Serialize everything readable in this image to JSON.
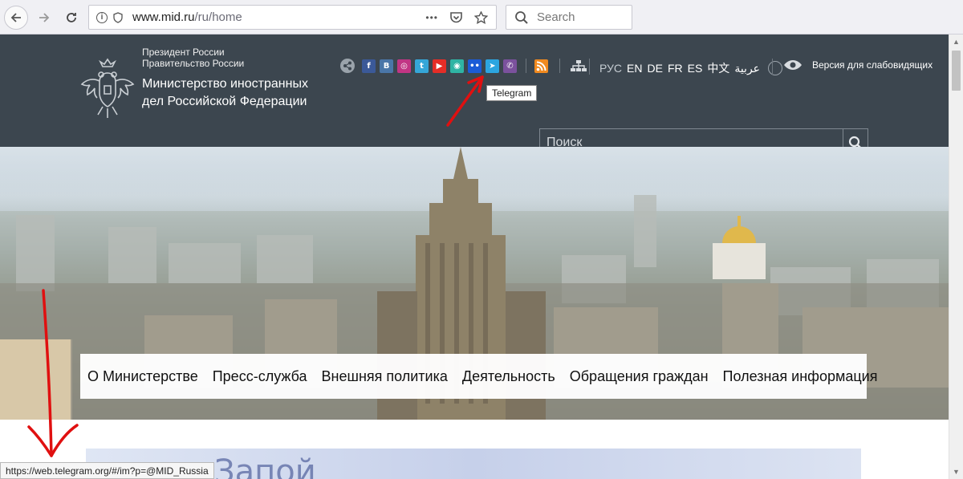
{
  "browser": {
    "url_host": "www.mid.ru",
    "url_path": "/ru/home",
    "search_placeholder": "Search",
    "more_glyph": "•••"
  },
  "header": {
    "gov_line1": "Президент России",
    "gov_line2": "Правительство России",
    "ministry_name": "Министерство иностранных дел Российской Федерации",
    "languages": [
      "РУС",
      "EN",
      "DE",
      "FR",
      "ES",
      "中文",
      "عربية"
    ],
    "accessibility_label": "Версия для слабовидящих",
    "tooltip": "Telegram",
    "search_placeholder": "Поиск",
    "social_icons": [
      {
        "name": "facebook-icon",
        "glyph": "f",
        "color": "#3b5998"
      },
      {
        "name": "vk-icon",
        "glyph": "B",
        "color": "#4a76a8"
      },
      {
        "name": "instagram-icon",
        "glyph": "◎",
        "color": "#c13584"
      },
      {
        "name": "tumblr-icon",
        "glyph": "t",
        "color": "#35a6d8"
      },
      {
        "name": "youtube-icon",
        "glyph": "▶",
        "color": "#e52d27"
      },
      {
        "name": "maps-icon",
        "glyph": "◉",
        "color": "#2fb4a4"
      },
      {
        "name": "flickr-icon",
        "glyph": "••",
        "color": "#1b5bd6"
      },
      {
        "name": "telegram-icon",
        "glyph": "➤",
        "color": "#2ca5e0"
      },
      {
        "name": "viber-icon",
        "glyph": "✆",
        "color": "#7b519d"
      }
    ]
  },
  "menu": {
    "items": [
      "О Министерстве",
      "Пресс-служба",
      "Внешняя политика",
      "Деятельность",
      "Обращения граждан",
      "Полезная информация"
    ]
  },
  "banner": {
    "text": "Запой"
  },
  "status_bar": {
    "link": "https://web.telegram.org/#/im?p=@MID_Russia"
  },
  "colors": {
    "header_bg": "#3c464f",
    "annotation_red": "#e01010"
  }
}
